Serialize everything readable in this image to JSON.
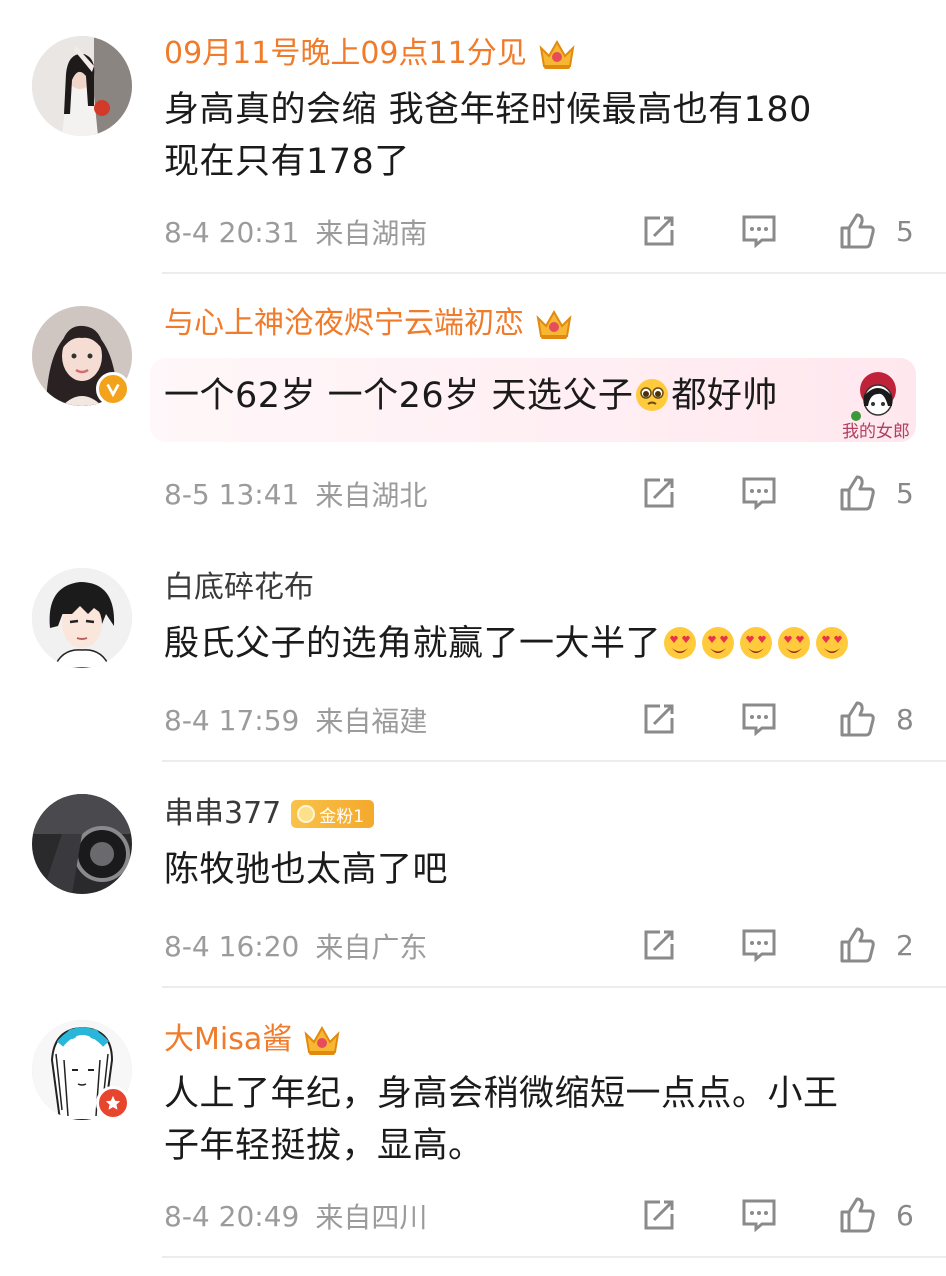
{
  "comments": [
    {
      "username": "09月11号晚上09点11分见",
      "text_lines": [
        "身高真的会缩 我爸年轻时候最高也有180",
        "现在只有178了"
      ],
      "time": "8-4 20:31",
      "location": "来自湖南",
      "likes": "5",
      "avatar_icon": "avatar-girl-photo-icon",
      "name_style": "vip"
    },
    {
      "username": "与心上神沧夜烬宁云端初恋",
      "text_parts": [
        "一个62岁  一个26岁  天选父子",
        "都好帅"
      ],
      "bubble_tag": "我的女郎",
      "time": "8-5 13:41",
      "location": "来自湖北",
      "likes": "5",
      "name_style": "vip",
      "verified": true
    },
    {
      "username": "白底碎花布",
      "text": "殷氏父子的选角就赢了一大半了",
      "emoji_count": 5,
      "time": "8-4 17:59",
      "location": "来自福建",
      "likes": "8",
      "name_style": "normal"
    },
    {
      "username": "串串377",
      "fan_badge": "金粉1",
      "text": "陈牧驰也太高了吧",
      "time": "8-4 16:20",
      "location": "来自广东",
      "likes": "2",
      "name_style": "normal"
    },
    {
      "username": "大Misa酱",
      "text_lines": [
        "人上了年纪，身高会稍微缩短一点点。小王",
        "子年轻挺拔，显高。"
      ],
      "time": "8-4 20:49",
      "location": "来自四川",
      "likes": "6",
      "name_style": "vip"
    }
  ],
  "colors": {
    "vip_name": "#f07b2a",
    "meta_gray": "#9b9b9b",
    "crown_gold": "#f3a21b"
  },
  "icons": [
    "share-icon",
    "reply-icon",
    "like-icon",
    "crown-icon"
  ]
}
